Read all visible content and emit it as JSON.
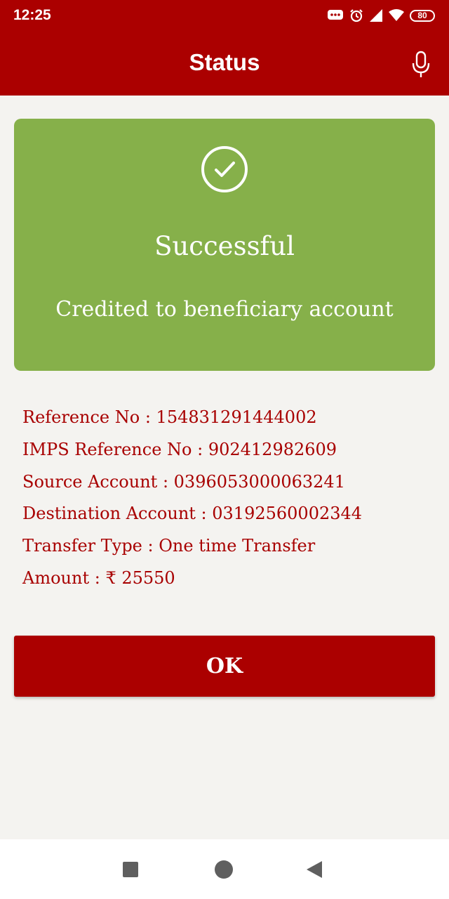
{
  "status_bar": {
    "time": "12:25",
    "battery": "80",
    "icons": [
      "chat-notification-icon",
      "alarm-icon",
      "signal-icon",
      "wifi-icon",
      "battery-icon"
    ]
  },
  "app_bar": {
    "title": "Status",
    "action_icon": "mic-icon"
  },
  "result_card": {
    "icon": "check-circle-icon",
    "headline": "Successful",
    "message": "Credited to beneficiary account",
    "color": "#86b04a"
  },
  "details": [
    "Reference No : 154831291444002",
    "IMPS Reference No : 902412982609",
    "Source Account : 0396053000063241",
    "Destination Account : 03192560002344",
    "Transfer Type : One time Transfer",
    "Amount : ₹ 25550"
  ],
  "ok_button": {
    "label": "OK"
  },
  "nav_bar": {
    "icons": [
      "recents-icon",
      "home-icon",
      "back-icon"
    ]
  },
  "colors": {
    "brand": "#ab0000",
    "detail_text": "#a80000",
    "background": "#f4f3f0"
  }
}
